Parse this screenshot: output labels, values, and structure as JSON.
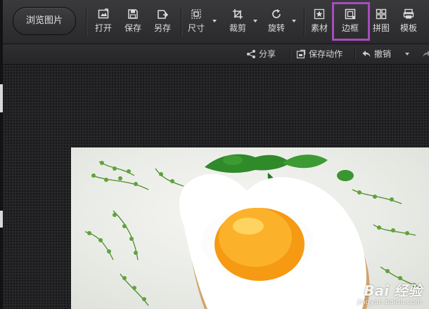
{
  "toolbar": {
    "browse_label": "浏览图片",
    "tools": [
      {
        "label": "打开",
        "icon": "open-icon"
      },
      {
        "label": "保存",
        "icon": "save-icon"
      },
      {
        "label": "另存",
        "icon": "save-as-icon"
      },
      {
        "label": "尺寸",
        "icon": "resize-icon"
      },
      {
        "label": "裁剪",
        "icon": "crop-icon"
      },
      {
        "label": "旋转",
        "icon": "rotate-icon"
      },
      {
        "label": "素材",
        "icon": "material-icon"
      },
      {
        "label": "边框",
        "icon": "border-icon"
      },
      {
        "label": "拼图",
        "icon": "collage-icon"
      },
      {
        "label": "模板",
        "icon": "template-icon"
      }
    ],
    "highlighted_tool": "边框",
    "highlight_color": "#a64cc0"
  },
  "subbar": {
    "share_label": "分享",
    "save_action_label": "保存动作",
    "undo_label": "撤销"
  },
  "watermark": {
    "brand": "Bai 经验",
    "url": "jingyan.baidu.com"
  }
}
